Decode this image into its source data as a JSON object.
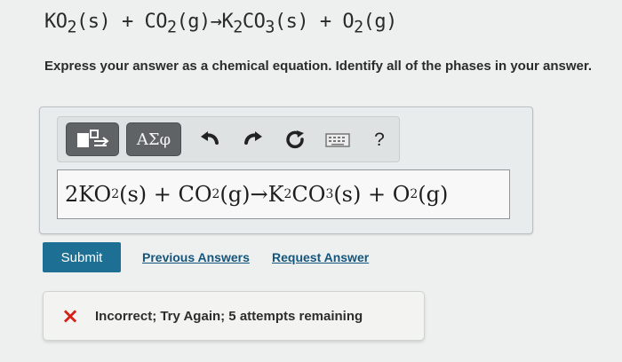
{
  "problem": {
    "equation_parts": [
      {
        "text": "KO",
        "type": "normal"
      },
      {
        "text": "2",
        "type": "sub"
      },
      {
        "text": "(s) + CO",
        "type": "normal"
      },
      {
        "text": "2",
        "type": "sub"
      },
      {
        "text": "(g)→K",
        "type": "normal"
      },
      {
        "text": "2",
        "type": "sub"
      },
      {
        "text": "CO",
        "type": "normal"
      },
      {
        "text": "3",
        "type": "sub"
      },
      {
        "text": "(s) + O",
        "type": "normal"
      },
      {
        "text": "2",
        "type": "sub"
      },
      {
        "text": "(g)",
        "type": "normal"
      }
    ],
    "instruction": "Express your answer as a chemical equation. Identify all of the phases in your answer."
  },
  "toolbar": {
    "greek_label": "ΑΣφ",
    "help_label": "?"
  },
  "answer": {
    "parts": [
      {
        "text": "2KO",
        "type": "normal"
      },
      {
        "text": "2",
        "type": "sub"
      },
      {
        "text": " (s) + CO",
        "type": "normal"
      },
      {
        "text": "2",
        "type": "sub"
      },
      {
        "text": " (g)→K",
        "type": "normal"
      },
      {
        "text": "2",
        "type": "sub"
      },
      {
        "text": " CO",
        "type": "normal"
      },
      {
        "text": "3",
        "type": "sub"
      },
      {
        "text": " (s) + O",
        "type": "normal"
      },
      {
        "text": "2",
        "type": "sub"
      },
      {
        "text": " (g)",
        "type": "normal"
      }
    ]
  },
  "actions": {
    "submit": "Submit",
    "previous_answers": "Previous Answers",
    "request_answer": "Request Answer"
  },
  "feedback": {
    "text": "Incorrect; Try Again; 5 attempts remaining"
  },
  "colors": {
    "submit": "#1d6f93",
    "link": "#15557b",
    "error": "#d71f16"
  },
  "icons": {
    "template": "template-icon",
    "undo": "undo-icon",
    "redo": "redo-icon",
    "reset": "reset-icon",
    "keyboard": "keyboard-icon",
    "help": "question-icon",
    "error": "x-icon"
  }
}
